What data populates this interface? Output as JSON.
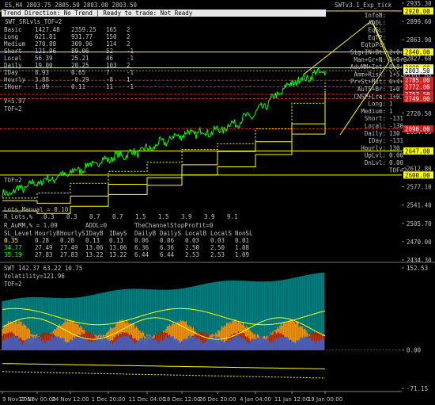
{
  "header": {
    "symbol_line": "ES,H4  2803.75 2805.50 2803.00 2803.50",
    "status": "Trend Direction: No Trend  |  Ready to trade: Not Ready",
    "expert": "SWTv3.1_Exp_tick",
    "sub_title": "SWT_SRLvls_TOF=2"
  },
  "stats_table": {
    "rows": [
      {
        "name": "Basic",
        "c1": "1427.48",
        "c2": "2359.25",
        "c3": "165",
        "c4": "2"
      },
      {
        "name": "Long",
        "c1": "621.81",
        "c2": "931.77",
        "c3": "150",
        "c4": "2"
      },
      {
        "name": "Medium",
        "c1": "270.88",
        "c2": "309.96",
        "c3": "114",
        "c4": "2"
      },
      {
        "name": "Short",
        "c1": "121.96",
        "c2": "89.06",
        "c3": "52",
        "c4": "-1"
      },
      {
        "name": "Local",
        "c1": "56.39",
        "c2": "25.21",
        "c3": "46",
        "c4": "-1"
      },
      {
        "name": "Daily",
        "c1": "19.00",
        "c2": "20.25",
        "c3": "103",
        "c4": "2"
      },
      {
        "name": "IDay",
        "c1": "8.93",
        "c2": "0.65",
        "c3": "7",
        "c4": "-1"
      },
      {
        "name": "Hourly",
        "c1": "3.88",
        "c2": "-0.29",
        "c3": "-8",
        "c4": "1"
      },
      {
        "name": "IHour",
        "c1": "1.09",
        "c2": "0.11",
        "c3": "11",
        "c4": "-1"
      }
    ],
    "v_line": "V=5.97",
    "tof_line": "TOF=2"
  },
  "right_panel": {
    "rows": [
      {
        "label": "InfoB:",
        "val": ""
      },
      {
        "label": "ADDL:",
        "val": ""
      },
      {
        "label": "EqSL:",
        "val": ""
      },
      {
        "label": "EqTP:",
        "val": ""
      },
      {
        "label": "EqtpPc:",
        "val": ""
      },
      {
        "label": "Sig+IN+Bt:",
        "val": "2+0+0"
      },
      {
        "label": "Man+Gr+N:",
        "val": "0+0+0"
      },
      {
        "label": "AdvMM+Int:",
        "val": "0+0+10"
      },
      {
        "label": "Amm+Risk:",
        "val": "1+5.0"
      },
      {
        "label": "Pr+St+Mst:",
        "val": "6+4+1"
      },
      {
        "label": "AuTS+Br:",
        "val": "1+0"
      },
      {
        "label": "CNSP+Lre:",
        "val": "1+0"
      },
      {
        "label": "Long:",
        "val": "1"
      },
      {
        "label": "Medium:",
        "val": "1"
      },
      {
        "label": "Short:",
        "val": "-131"
      },
      {
        "label": "Local:",
        "val": "-130"
      },
      {
        "label": "Daily:",
        "val": "130"
      },
      {
        "label": "IDay:",
        "val": "-131"
      },
      {
        "label": "Hourly:",
        "val": "130"
      },
      {
        "label": "UpLvl:",
        "val": "0.00"
      },
      {
        "label": "DnLvl:",
        "val": "0.00"
      },
      {
        "label": "",
        "val": "TOF=2"
      }
    ]
  },
  "bottom_left": {
    "tof": "TOF=2",
    "lots": "Lots_Manual = 0.10",
    "rlots_label": "R_Lots,%",
    "rlots_values": [
      "0.3",
      "0.3",
      "0.7",
      "0.7",
      "1.5",
      "1.5",
      "3.9",
      "3.9",
      "9.1"
    ],
    "automm": "R_AuMM,% = 1.09",
    "addl": "ADDL=0",
    "channel": "TheChannelStopProfit=0",
    "sl_headers": [
      "SL_Level",
      "HourlyB",
      "HourlyS",
      "IDayB",
      "IDayS",
      "DailyB",
      "DailyS",
      "LocalB",
      "LocalS",
      "NonSL"
    ],
    "sl_rows": [
      {
        "c": [
          "0.35",
          "0.28",
          "0.28",
          "0.13",
          "0.13",
          "0.06",
          "0.06",
          "0.03",
          "0.03",
          "0.01"
        ],
        "color": "#ffff00"
      },
      {
        "c": [
          "34.77",
          "27.49",
          "27.49",
          "13.06",
          "13.06",
          "6.36",
          "6.36",
          "2.50",
          "2.50",
          "1.08"
        ],
        "color": "#00ff00"
      },
      {
        "c": [
          "35.19",
          "27.83",
          "27.83",
          "13.22",
          "13.22",
          "6.44",
          "6.44",
          "2.53",
          "2.53",
          "1.09"
        ],
        "color": "#00ff00"
      }
    ]
  },
  "price_axis": {
    "ticks": [
      "2935.30",
      "2899.60",
      "2863.90",
      "2827.60",
      "2791.90",
      "2756.20",
      "2720.50",
      "2684.80",
      "2648.50",
      "2612.80",
      "2577.10",
      "2541.40",
      "2505.70",
      "2470.00",
      "2434.30"
    ],
    "tick_values": [
      2935.3,
      2899.6,
      2863.9,
      2827.6,
      2791.9,
      2756.2,
      2720.5,
      2684.8,
      2648.5,
      2612.8,
      2577.1,
      2541.4,
      2505.7,
      2470.0,
      2434.3
    ],
    "levels": [
      {
        "label": "2920.00",
        "value": 2920.0,
        "bg": "#ffff00",
        "fg": "#000000",
        "line": "#ffff00"
      },
      {
        "label": "2840.00",
        "value": 2840.0,
        "bg": "#ffff00",
        "fg": "#000000",
        "line": "#ffff00"
      },
      {
        "label": "2809.00",
        "value": 2809.0,
        "bg": "#ffff00",
        "fg": "#000000",
        "line": "#ffff00"
      },
      {
        "label": "2803.50",
        "value": 2803.5,
        "bg": "#ffffff",
        "fg": "#000000",
        "line": "#888888"
      },
      {
        "label": "2785.00",
        "value": 2785.0,
        "bg": "#d02020",
        "fg": "#ffffff",
        "line": "#d02020"
      },
      {
        "label": "2772.00",
        "value": 2772.0,
        "bg": "#d02020",
        "fg": "#ffffff",
        "line": "#d02020"
      },
      {
        "label": "2757.50",
        "value": 2757.5,
        "bg": "#d02020",
        "fg": "#ffffff",
        "line": "#d02020"
      },
      {
        "label": "2749.00",
        "value": 2749.0,
        "bg": "#d02020",
        "fg": "#ffffff",
        "line": "#d02020"
      },
      {
        "label": "2690.00",
        "value": 2690.0,
        "bg": "#d02020",
        "fg": "#ffffff",
        "line": "#d02020"
      },
      {
        "label": "2647.00",
        "value": 2647.0,
        "bg": "#ffff00",
        "fg": "#000000",
        "line": "#ffff00"
      },
      {
        "label": "2600.00",
        "value": 2600.0,
        "bg": "#ffff00",
        "fg": "#000000",
        "line": "#ffff00"
      }
    ]
  },
  "indicator": {
    "header": "SWT 142.37 63.22 10.75",
    "volatility": "Volatility=121.96",
    "tof": "TOF=2",
    "ticks": [
      "152.53",
      "0.00",
      "-71.15"
    ],
    "tick_values": [
      152.53,
      0.0,
      -71.15
    ]
  },
  "time_axis": [
    "9 Nov 2017",
    "17 Nov 00:00",
    "24 Nov 12:00",
    "1 Dec 20:00",
    "11 Dec 04:00",
    "18 Dec 12:00",
    "26 Dec 20:00",
    "4 Jan 04:00",
    "11 Jan 12:00",
    "19 Jan 00:00"
  ],
  "chart_data": {
    "type": "line",
    "x": [
      "9 Nov 2017",
      "17 Nov 00:00",
      "24 Nov 12:00",
      "1 Dec 20:00",
      "11 Dec 04:00",
      "18 Dec 12:00",
      "26 Dec 20:00",
      "4 Jan 04:00",
      "11 Jan 12:00",
      "19 Jan 00:00"
    ],
    "series": [
      {
        "values": [
          2560,
          2585,
          2604,
          2632,
          2650,
          2680,
          2686,
          2720,
          2780,
          2803.5
        ]
      }
    ],
    "ylim": [
      2434.3,
      2935.3
    ]
  },
  "colors": {
    "price": "#00ff00",
    "support_yellow": "#ffff00",
    "resistance_red": "#d02020",
    "hist_teal": "#008080",
    "hist_orange": "#ff8c00",
    "hist_red": "#b22000",
    "hist_blue": "#3a5fcd"
  }
}
